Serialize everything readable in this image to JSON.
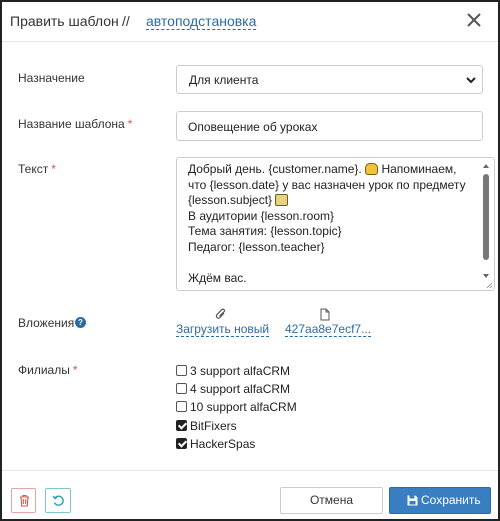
{
  "header": {
    "title": "Править шаблон",
    "separator": "//",
    "name_link": "автоподстановка"
  },
  "form": {
    "purpose": {
      "label": "Назначение",
      "value": "Для клиента"
    },
    "template_name": {
      "label": "Название шаблона",
      "required": "*",
      "value": "Оповещение об уроках"
    },
    "text": {
      "label": "Текст",
      "required": "*",
      "lines": [
        "Добрый день. {customer.name}.",
        "Напоминаем,",
        "что {lesson.date} у вас назначен урок по предмету",
        "{lesson.subject}",
        "В аудитории {lesson.room}",
        "Тема занятия: {lesson.topic}",
        "Педагог: {lesson.teacher}",
        "",
        "Ждём вас."
      ]
    },
    "attachments": {
      "label": "Вложения",
      "help": "?",
      "upload_label": "Загрузить новый",
      "file_label": "427aa8e7ecf7..."
    },
    "branches": {
      "label": "Филиалы",
      "required": "*",
      "items": [
        {
          "label": "3 support alfaCRM",
          "checked": false
        },
        {
          "label": "4 support alfaCRM",
          "checked": false
        },
        {
          "label": "10 support alfaCRM",
          "checked": false
        },
        {
          "label": "BitFixers",
          "checked": true
        },
        {
          "label": "HackerSpas",
          "checked": true
        }
      ]
    }
  },
  "footer": {
    "cancel_label": "Отмена",
    "save_label": "Сохранить"
  },
  "colors": {
    "link": "#2b6aa8",
    "required": "#d9534f",
    "save_bg": "#3a7ec2",
    "delete_border": "#e3a6a3",
    "restore_border": "#7fc7cf"
  },
  "icons": {
    "close": "close-icon",
    "dropdown": "chevron-down-icon",
    "help": "help-circle-icon",
    "upload": "paperclip-icon",
    "file": "file-icon",
    "delete": "trash-icon",
    "restore": "undo-icon",
    "save": "floppy-disk-icon"
  }
}
